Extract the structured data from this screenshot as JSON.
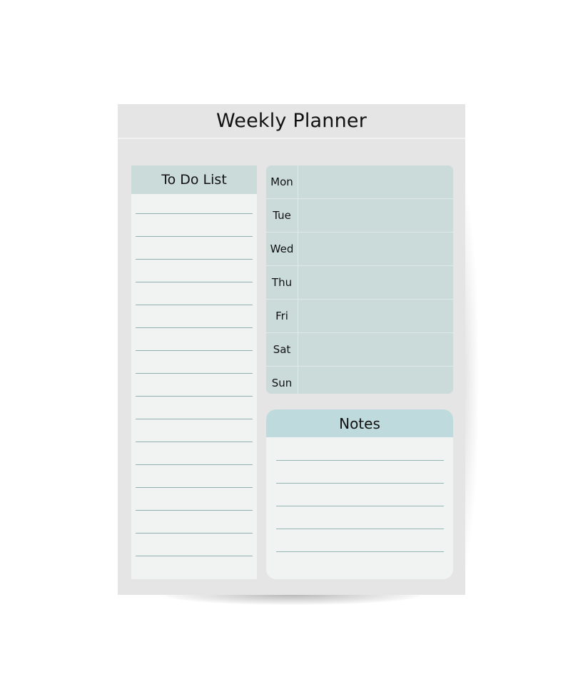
{
  "planner": {
    "title": "Weekly Planner",
    "todo": {
      "heading": "To Do List",
      "line_count": 16
    },
    "week": {
      "days": [
        "Mon",
        "Tue",
        "Wed",
        "Thu",
        "Fri",
        "Sat",
        "Sun"
      ]
    },
    "notes": {
      "heading": "Notes",
      "line_count": 5
    },
    "colors": {
      "sheet": "#e5e5e5",
      "panel": "#f1f3f2",
      "header_teal": "#cbdbda",
      "notes_header": "#bfdadc",
      "rule_line": "#8fb0ae"
    }
  }
}
